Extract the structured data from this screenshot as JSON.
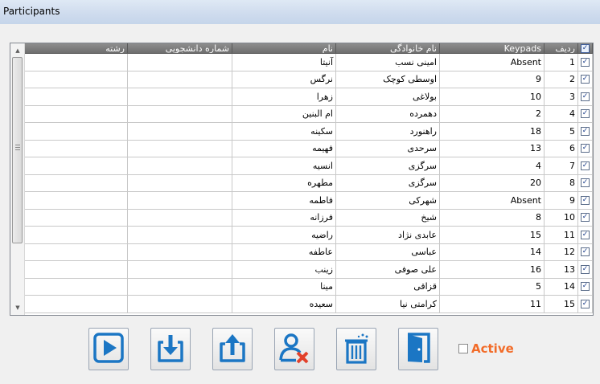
{
  "window": {
    "title": "Participants"
  },
  "grid": {
    "headers": {
      "select_all": "✓",
      "row_no": "ردیف",
      "keypads": "Keypads",
      "family": "نام خانوادگی",
      "name": "نام",
      "student_id": "شماره دانشجویی",
      "major": "رشته"
    },
    "rows": [
      {
        "row": "1",
        "keypad": "Absent",
        "family": "امینی نسب",
        "name": "آنیتا",
        "student_id": "",
        "major": ""
      },
      {
        "row": "2",
        "keypad": "9",
        "family": "اوسطی کوچک",
        "name": "نرگس",
        "student_id": "",
        "major": ""
      },
      {
        "row": "3",
        "keypad": "10",
        "family": "بولاغی",
        "name": "زهرا",
        "student_id": "",
        "major": ""
      },
      {
        "row": "4",
        "keypad": "2",
        "family": "دهمرده",
        "name": "ام البنین",
        "student_id": "",
        "major": ""
      },
      {
        "row": "5",
        "keypad": "18",
        "family": "راهنورد",
        "name": "سکینه",
        "student_id": "",
        "major": ""
      },
      {
        "row": "6",
        "keypad": "13",
        "family": "سرحدی",
        "name": "فهیمه",
        "student_id": "",
        "major": ""
      },
      {
        "row": "7",
        "keypad": "4",
        "family": "سرگزی",
        "name": "انسیه",
        "student_id": "",
        "major": ""
      },
      {
        "row": "8",
        "keypad": "20",
        "family": "سرگزی",
        "name": "مطهره",
        "student_id": "",
        "major": ""
      },
      {
        "row": "9",
        "keypad": "Absent",
        "family": "شهرکی",
        "name": "فاطمه",
        "student_id": "",
        "major": ""
      },
      {
        "row": "10",
        "keypad": "8",
        "family": "شیخ",
        "name": "فرزانه",
        "student_id": "",
        "major": ""
      },
      {
        "row": "11",
        "keypad": "15",
        "family": "عابدی نژاد",
        "name": "راضیه",
        "student_id": "",
        "major": ""
      },
      {
        "row": "12",
        "keypad": "14",
        "family": "عباسی",
        "name": "عاطفه",
        "student_id": "",
        "major": ""
      },
      {
        "row": "13",
        "keypad": "16",
        "family": "علی صوفی",
        "name": "زینب",
        "student_id": "",
        "major": ""
      },
      {
        "row": "14",
        "keypad": "5",
        "family": "قزاقی",
        "name": "مینا",
        "student_id": "",
        "major": ""
      },
      {
        "row": "15",
        "keypad": "11",
        "family": "کرامتی نیا",
        "name": "سعیده",
        "student_id": "",
        "major": ""
      }
    ],
    "scroll_position": 0
  },
  "toolbar": {
    "buttons": [
      {
        "id": "play",
        "icon": "play-icon"
      },
      {
        "id": "import",
        "icon": "download-icon"
      },
      {
        "id": "export",
        "icon": "upload-icon"
      },
      {
        "id": "remove-user",
        "icon": "remove-user-icon"
      },
      {
        "id": "delete",
        "icon": "trash-icon"
      },
      {
        "id": "exit",
        "icon": "exit-door-icon"
      }
    ]
  },
  "active": {
    "label": "Active",
    "checked": false
  },
  "colors": {
    "accent_blue": "#1b76c4",
    "active_orange": "#f26b28",
    "delete_red": "#e2412b",
    "header_gray": "#7e7e7e"
  }
}
